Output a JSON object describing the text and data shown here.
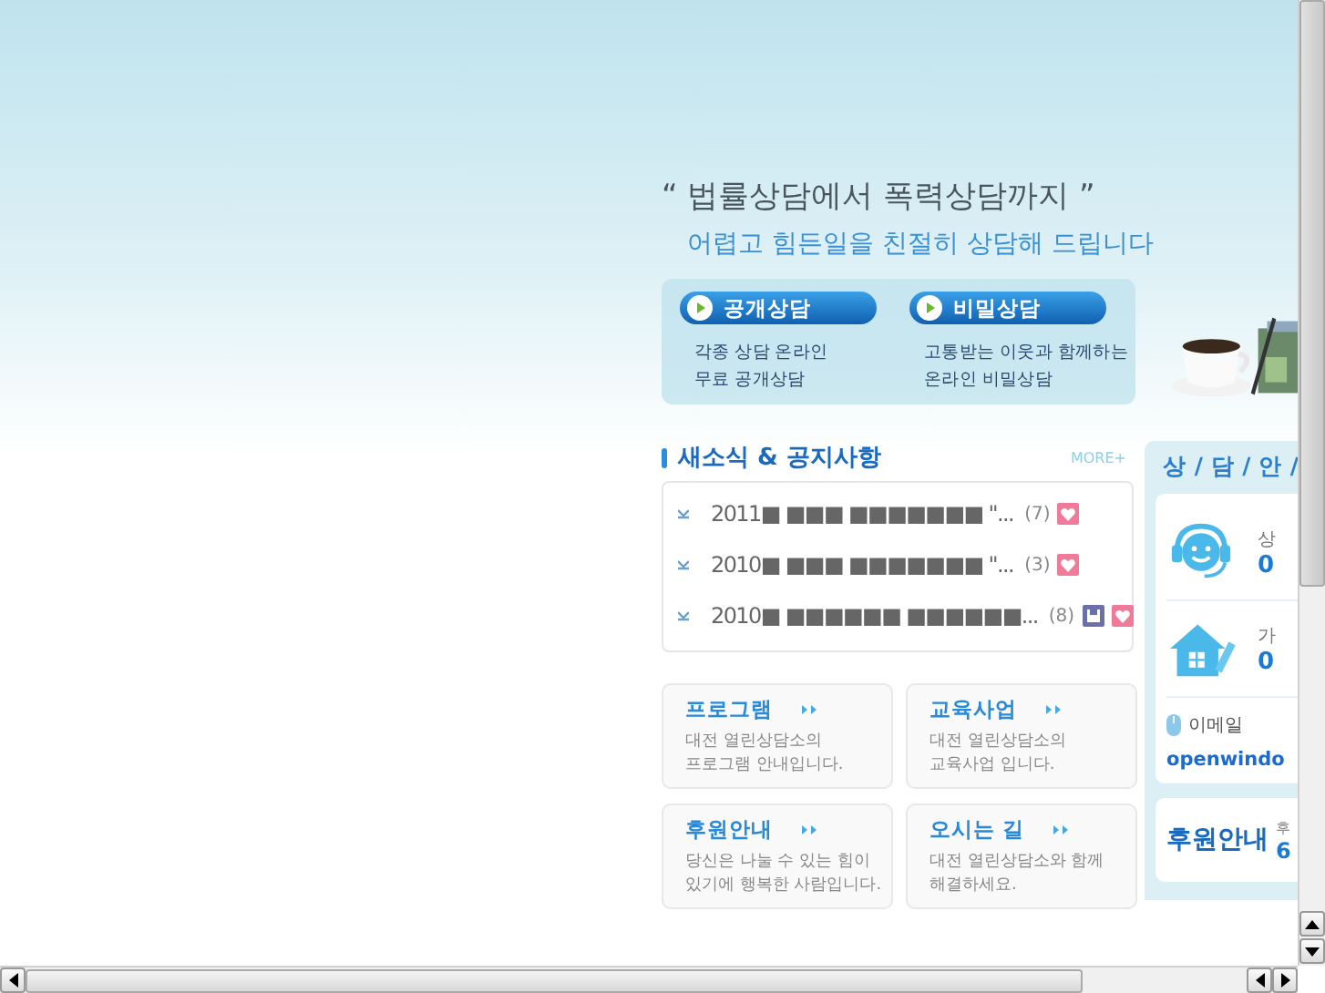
{
  "headline": "“ 법률상담에서  폭력상담까지 ”",
  "subtitle": "어렵고 힘든일을 친절히 상담해 드립니다",
  "consult": [
    {
      "title": "공개상담",
      "lines": [
        "각종 상담 온라인",
        "무료 공개상담"
      ]
    },
    {
      "title": "비밀상담",
      "lines": [
        "고통받는 이웃과 함께하는",
        "온라인 비밀상담"
      ]
    }
  ],
  "news": {
    "title": "새소식 & 공지사항",
    "more": "MORE+",
    "items": [
      {
        "text": "2011■ ■■■ ■■■■■■■ \"...",
        "count": "(7)",
        "icons": [
          {
            "kind": "heart"
          }
        ]
      },
      {
        "text": "2010■ ■■■ ■■■■■■■ \"...",
        "count": "(3)",
        "icons": [
          {
            "kind": "heart"
          }
        ]
      },
      {
        "text": "2010■ ■■■■■■ ■■■■■■...",
        "count": "(8)",
        "icons": [
          {
            "kind": "document"
          },
          {
            "kind": "heart"
          }
        ]
      }
    ]
  },
  "cards": [
    {
      "title": "프로그램",
      "desc": [
        "대전 열린상담소의",
        "프로그램 안내입니다."
      ]
    },
    {
      "title": "교육사업",
      "desc": [
        "대전 열린상담소의",
        "교육사업 입니다."
      ]
    },
    {
      "title": "후원안내",
      "desc": [
        "당신은 나눌 수 있는 힘이",
        "있기에 행복한 사람입니다."
      ]
    },
    {
      "title": "오시는 길",
      "desc": [
        "대전 열린상담소와 함께",
        "해결하세요."
      ]
    }
  ],
  "side": {
    "title": "상 / 담 / 안 /",
    "contacts": [
      {
        "kind": "headset",
        "label": "상",
        "value": "0"
      },
      {
        "kind": "house",
        "label": "가",
        "value": "0"
      }
    ],
    "email": {
      "label": "이메일",
      "value": "openwindo"
    },
    "support": {
      "title": "후원안내",
      "label": "후",
      "value": "6"
    }
  }
}
